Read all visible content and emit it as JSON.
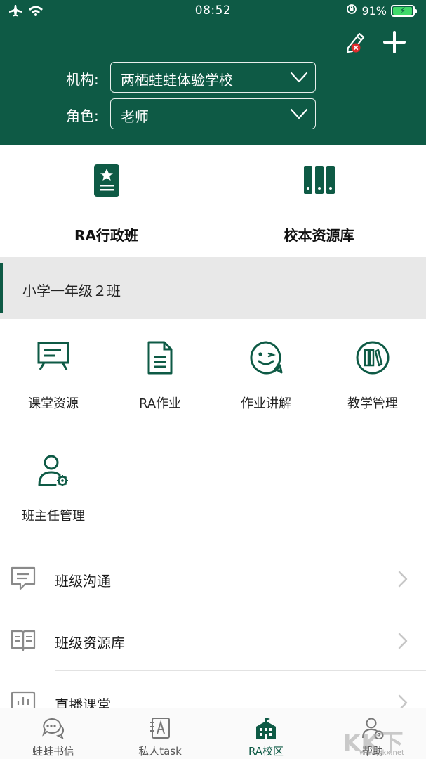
{
  "status_bar": {
    "time": "08:52",
    "battery": "91%"
  },
  "header": {
    "org_label": "机构:",
    "org_value": "两栖蛙蛙体验学校",
    "role_label": "角色:",
    "role_value": "老师"
  },
  "features": [
    {
      "label": "RA行政班",
      "icon": "class-book-icon"
    },
    {
      "label": "校本资源库",
      "icon": "library-icon"
    }
  ],
  "class_banner": {
    "title": "小学一年级２班"
  },
  "grid": [
    {
      "label": "课堂资源",
      "icon": "presentation-board-icon"
    },
    {
      "label": "RA作业",
      "icon": "document-icon"
    },
    {
      "label": "作业讲解",
      "icon": "wink-face-icon"
    },
    {
      "label": "教学管理",
      "icon": "books-circle-icon"
    },
    {
      "label": "班主任管理",
      "icon": "user-gear-icon"
    }
  ],
  "list": [
    {
      "label": "班级沟通",
      "icon": "chat-icon"
    },
    {
      "label": "班级资源库",
      "icon": "open-book-icon"
    },
    {
      "label": "直播课堂",
      "icon": "monitor-chart-icon"
    }
  ],
  "tabs": [
    {
      "label": "蛙蛙书信",
      "icon": "chat-bubbles-icon",
      "active": false
    },
    {
      "label": "私人task",
      "icon": "notebook-a-icon",
      "active": false
    },
    {
      "label": "RA校区",
      "icon": "school-building-icon",
      "active": true
    },
    {
      "label": "帮助",
      "icon": "help-user-icon",
      "active": false
    }
  ],
  "watermark": {
    "text": "KK下载",
    "sub": "www.kkx.net"
  },
  "colors": {
    "brand": "#0e5a45",
    "banner_bg": "#e8e8e8",
    "icon_gray": "#888888"
  }
}
